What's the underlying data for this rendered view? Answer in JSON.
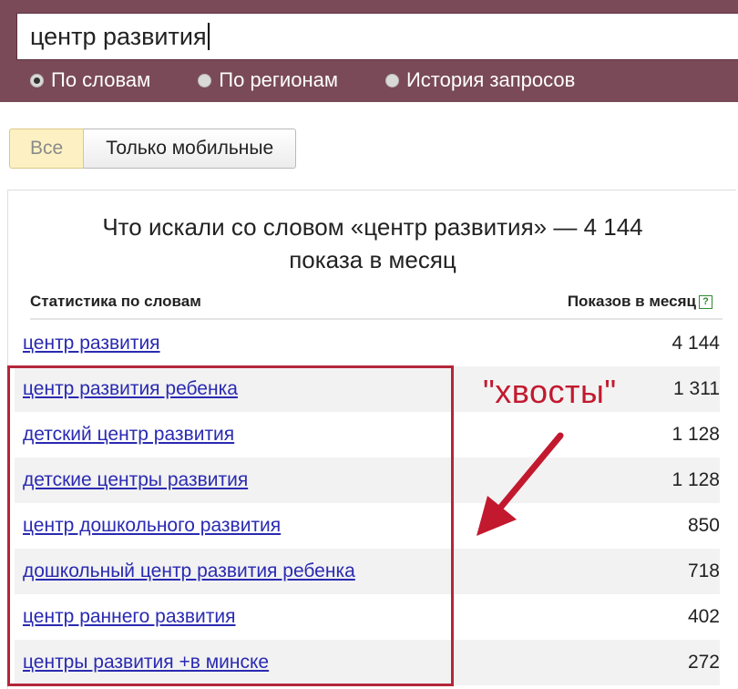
{
  "search": {
    "query": "центр развития",
    "modes": [
      {
        "label": "По словам",
        "checked": true
      },
      {
        "label": "По регионам",
        "checked": false
      },
      {
        "label": "История запросов",
        "checked": false
      }
    ]
  },
  "filters": {
    "all_label": "Все",
    "mobile_label": "Только мобильные",
    "active": "all"
  },
  "stats": {
    "title_line1": "Что искали со словом «центр развития» — 4 144",
    "title_line2": "показа в месяц",
    "col_words": "Статистика по словам",
    "col_shows": "Показов в месяц",
    "help_glyph": "?",
    "rows": [
      {
        "phrase": "центр развития",
        "count": "4 144"
      },
      {
        "phrase": "центр развития ребенка",
        "count": "1 311"
      },
      {
        "phrase": "детский центр развития",
        "count": "1 128"
      },
      {
        "phrase": "детские центры развития",
        "count": "1 128"
      },
      {
        "phrase": "центр дошкольного развития",
        "count": "850"
      },
      {
        "phrase": "дошкольный центр развития ребенка",
        "count": "718"
      },
      {
        "phrase": "центр раннего развития",
        "count": "402"
      },
      {
        "phrase": "центры развития +в минске",
        "count": "272"
      }
    ]
  },
  "annotation": {
    "label": "\"хвосты\"",
    "color": "#b3263a"
  },
  "colors": {
    "panel": "#7a4a58",
    "link": "#2a2ab2",
    "row_shade": "#f2f2f2"
  }
}
